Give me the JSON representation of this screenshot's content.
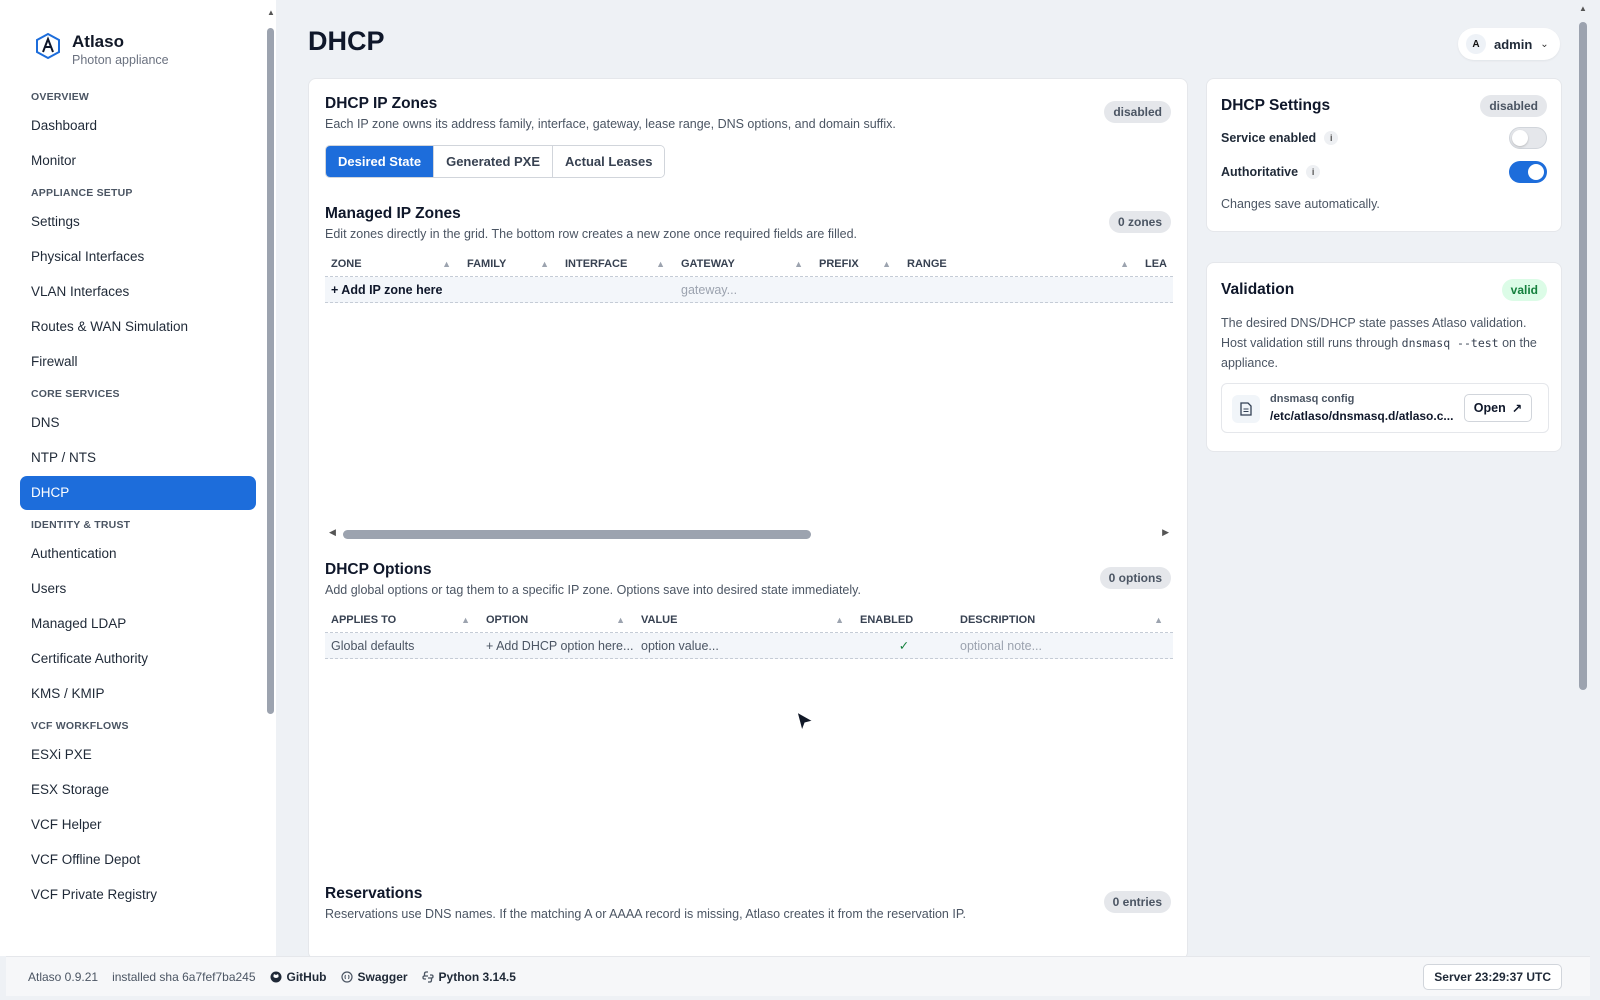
{
  "brand": {
    "name": "Atlaso",
    "subtitle": "Photon appliance"
  },
  "nav": {
    "sections": [
      {
        "title": "OVERVIEW",
        "items": [
          "Dashboard",
          "Monitor"
        ]
      },
      {
        "title": "APPLIANCE SETUP",
        "items": [
          "Settings",
          "Physical Interfaces",
          "VLAN Interfaces",
          "Routes & WAN Simulation",
          "Firewall"
        ]
      },
      {
        "title": "CORE SERVICES",
        "items": [
          "DNS",
          "NTP / NTS",
          "DHCP"
        ]
      },
      {
        "title": "IDENTITY & TRUST",
        "items": [
          "Authentication",
          "Users",
          "Managed LDAP",
          "Certificate Authority",
          "KMS / KMIP"
        ]
      },
      {
        "title": "VCF WORKFLOWS",
        "items": [
          "ESXi PXE",
          "ESX Storage",
          "VCF Helper",
          "VCF Offline Depot",
          "VCF Private Registry"
        ]
      }
    ],
    "active": "DHCP"
  },
  "header": {
    "title": "DHCP",
    "user_initial": "A",
    "user_name": "admin"
  },
  "zones": {
    "title": "DHCP IP Zones",
    "description": "Each IP zone owns its address family, interface, gateway, lease range, DNS options, and domain suffix.",
    "status": "disabled",
    "tabs": [
      "Desired State",
      "Generated PXE",
      "Actual Leases"
    ],
    "active_tab": "Desired State"
  },
  "managed": {
    "title": "Managed IP Zones",
    "description": "Edit zones directly in the grid. The bottom row creates a new zone once required fields are filled.",
    "count": "0 zones",
    "columns": [
      "ZONE",
      "FAMILY",
      "INTERFACE",
      "GATEWAY",
      "PREFIX",
      "RANGE",
      "LEA"
    ],
    "add_row": {
      "label": "+ Add IP zone here",
      "gateway_placeholder": "gateway..."
    }
  },
  "options": {
    "title": "DHCP Options",
    "description": "Add global options or tag them to a specific IP zone. Options save into desired state immediately.",
    "count": "0 options",
    "columns": [
      "APPLIES TO",
      "OPTION",
      "VALUE",
      "ENABLED",
      "DESCRIPTION"
    ],
    "row": {
      "applies_to": "Global defaults",
      "option": "+ Add DHCP option here...",
      "value": "option value...",
      "enabled": "✓",
      "description": "optional note..."
    }
  },
  "reservations": {
    "title": "Reservations",
    "description": "Reservations use DNS names. If the matching A or AAAA record is missing, Atlaso creates it from the reservation IP.",
    "count": "0 entries"
  },
  "settings": {
    "title": "DHCP Settings",
    "status": "disabled",
    "service_enabled_label": "Service enabled",
    "service_enabled": false,
    "authoritative_label": "Authoritative",
    "authoritative": true,
    "note": "Changes save automatically."
  },
  "validation": {
    "title": "Validation",
    "status": "valid",
    "text_1": "The desired DNS/DHCP state passes Atlaso validation. Host validation still runs through",
    "command": "dnsmasq --test",
    "text_2": "on the appliance.",
    "file_label": "dnsmasq config",
    "file_path": "/etc/atlaso/dnsmasq.d/atlaso.c...",
    "open_label": "Open"
  },
  "footer": {
    "version": "Atlaso 0.9.21",
    "sha": "installed sha 6a7fef7ba245",
    "github": "GitHub",
    "swagger": "Swagger",
    "python": "Python 3.14.5",
    "server_time": "Server 23:29:37 UTC"
  },
  "colors": {
    "accent": "#1d6ddb",
    "valid": "#15803d"
  }
}
